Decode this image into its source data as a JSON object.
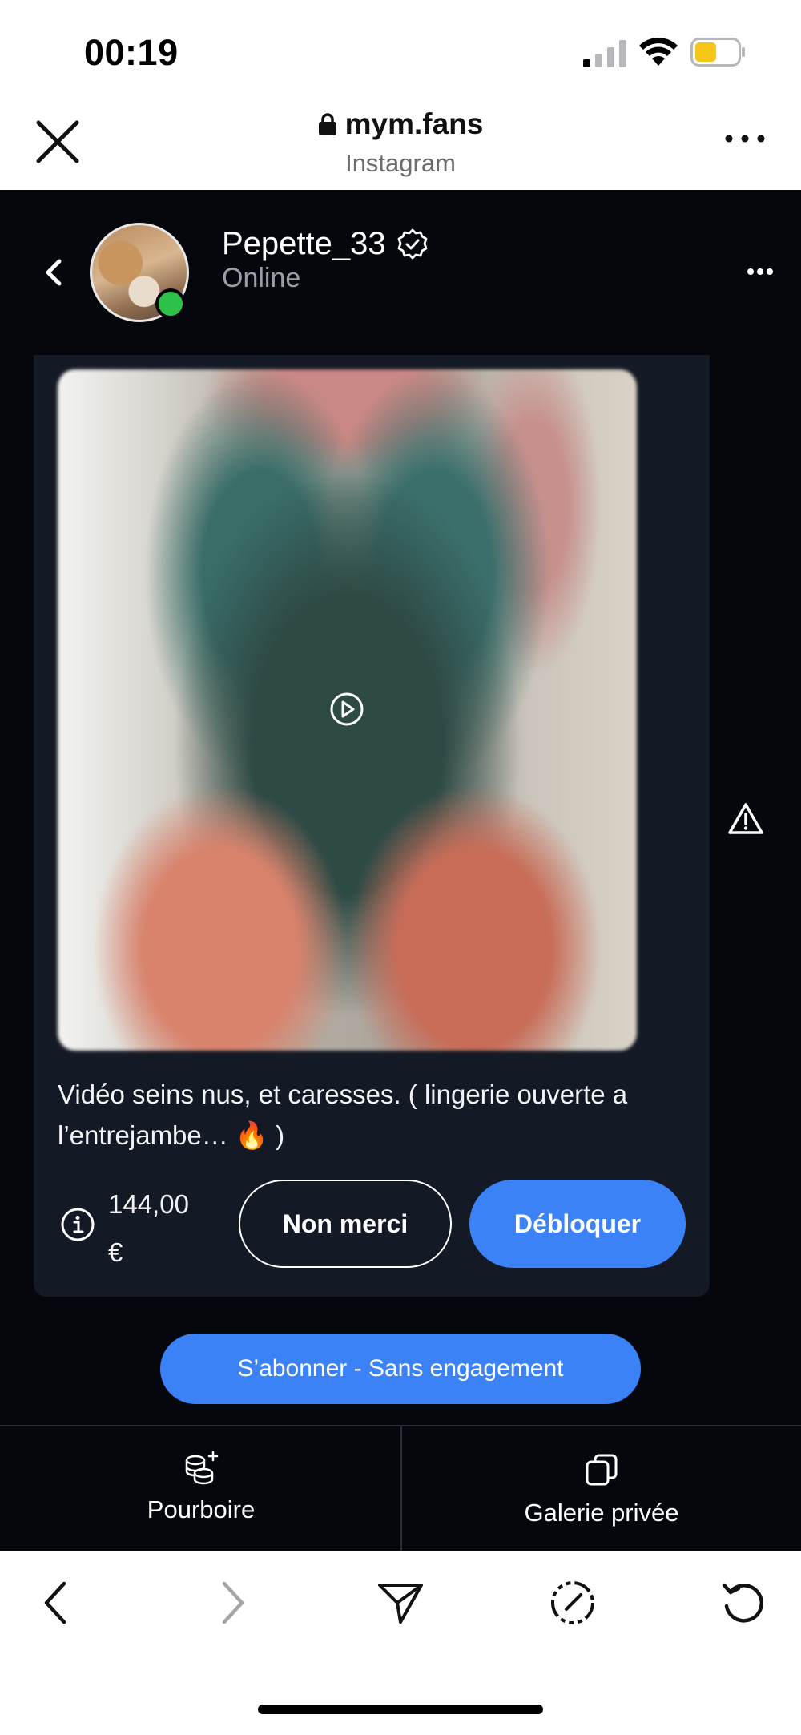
{
  "status_bar": {
    "time": "00:19"
  },
  "browser": {
    "domain": "mym.fans",
    "subtitle": "Instagram"
  },
  "profile": {
    "username": "Pepette_33",
    "status": "Online"
  },
  "message": {
    "caption": "Vidéo seins nus, et caresses. ( lingerie ouverte a l’entrejambe… 🔥 )",
    "price_amount": "144,00",
    "price_currency": "€",
    "decline_label": "Non merci",
    "unlock_label": "Débloquer"
  },
  "subscribe_label": "S’abonner - Sans engagement",
  "tabs": [
    {
      "label": "Pourboire",
      "icon": "coins-plus-icon"
    },
    {
      "label": "Galerie privée",
      "icon": "gallery-copy-icon"
    }
  ],
  "colors": {
    "accent": "#3b82f6",
    "background_dark": "#05070d",
    "card": "#141a25",
    "online": "#2ec14a"
  }
}
